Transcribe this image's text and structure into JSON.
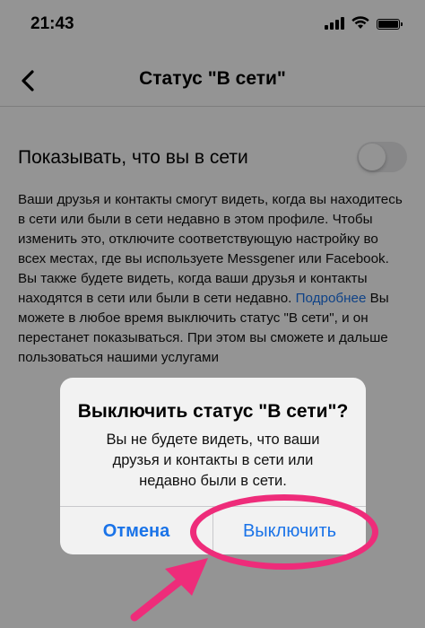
{
  "status_bar": {
    "time": "21:43"
  },
  "nav": {
    "title": "Статус \"В сети\""
  },
  "setting": {
    "label": "Показывать, что вы в сети",
    "toggle_on": false
  },
  "description": {
    "text_before_link": "Ваши друзья и контакты смогут видеть, когда вы находитесь в сети или были в сети недавно в этом профиле. Чтобы изменить это, отключите соответствующую настройку во всех местах, где вы используете Messgener или Facebook. Вы также будете видеть, когда ваши друзья и контакты находятся в сети или были в сети недавно. ",
    "link": "Подробнее",
    "text_after_link": " Вы можете в любое время выключить статус \"В сети\", и он перестанет показываться. При этом вы сможете и дальше пользоваться нашими услугами"
  },
  "alert": {
    "title": "Выключить статус \"В сети\"?",
    "message": "Вы не будете видеть, что ваши друзья и контакты в сети или недавно были в сети.",
    "cancel_label": "Отмена",
    "confirm_label": "Выключить"
  },
  "colors": {
    "accent": "#1a73e8",
    "annotation": "#ee2c7a"
  }
}
